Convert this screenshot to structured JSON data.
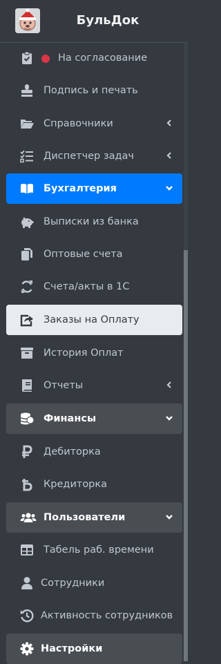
{
  "brand": {
    "name": "БульДок",
    "logo_icon": "bulldog-santa-logo"
  },
  "colors": {
    "sidebar_bg": "#343a40",
    "active_bg": "#007bff",
    "text": "#c2c7d0",
    "highlight_bg": "#e9ecef",
    "open_group_bg": "#494e53",
    "alert_dot": "#dc3545"
  },
  "nav": {
    "approval": {
      "label": "На согласование",
      "icon": "clipboard-check-icon",
      "badge_color": "#dc3545"
    },
    "signature": {
      "label": "Подпись и печать",
      "icon": "stamp-icon"
    },
    "directories": {
      "label": "Справочники",
      "icon": "folder-open-icon"
    },
    "task_manager": {
      "label": "Диспетчер задач",
      "icon": "tasks-icon"
    },
    "accounting": {
      "label": "Бухгалтерия",
      "icon": "book-open-icon"
    },
    "bank_statements": {
      "label": "Выписки из банка",
      "icon": "piggy-bank-icon"
    },
    "wholesale_invoices": {
      "label": "Оптовые счета",
      "icon": "copy-icon"
    },
    "invoices_1c": {
      "label": "Счета/акты в 1С",
      "icon": "sync-icon"
    },
    "payment_orders": {
      "label": "Заказы на Оплату",
      "icon": "share-square-icon"
    },
    "payment_history": {
      "label": "История Оплат",
      "icon": "archive-icon"
    },
    "reports": {
      "label": "Отчеты",
      "icon": "book-icon"
    },
    "finance": {
      "label": "Финансы",
      "icon": "coins-icon"
    },
    "receivables": {
      "label": "Дебиторка",
      "icon": "ruble-sign-icon"
    },
    "payables": {
      "label": "Кредиторка",
      "icon": "b-letter-icon"
    },
    "users": {
      "label": "Пользователи",
      "icon": "users-icon"
    },
    "timesheet": {
      "label": "Табель раб. времени",
      "icon": "table-icon"
    },
    "employees": {
      "label": "Сотрудники",
      "icon": "user-icon"
    },
    "employee_activity": {
      "label": "Активность сотрудников",
      "icon": "history-icon"
    },
    "settings": {
      "label": "Настройки",
      "icon": "cog-icon"
    }
  }
}
